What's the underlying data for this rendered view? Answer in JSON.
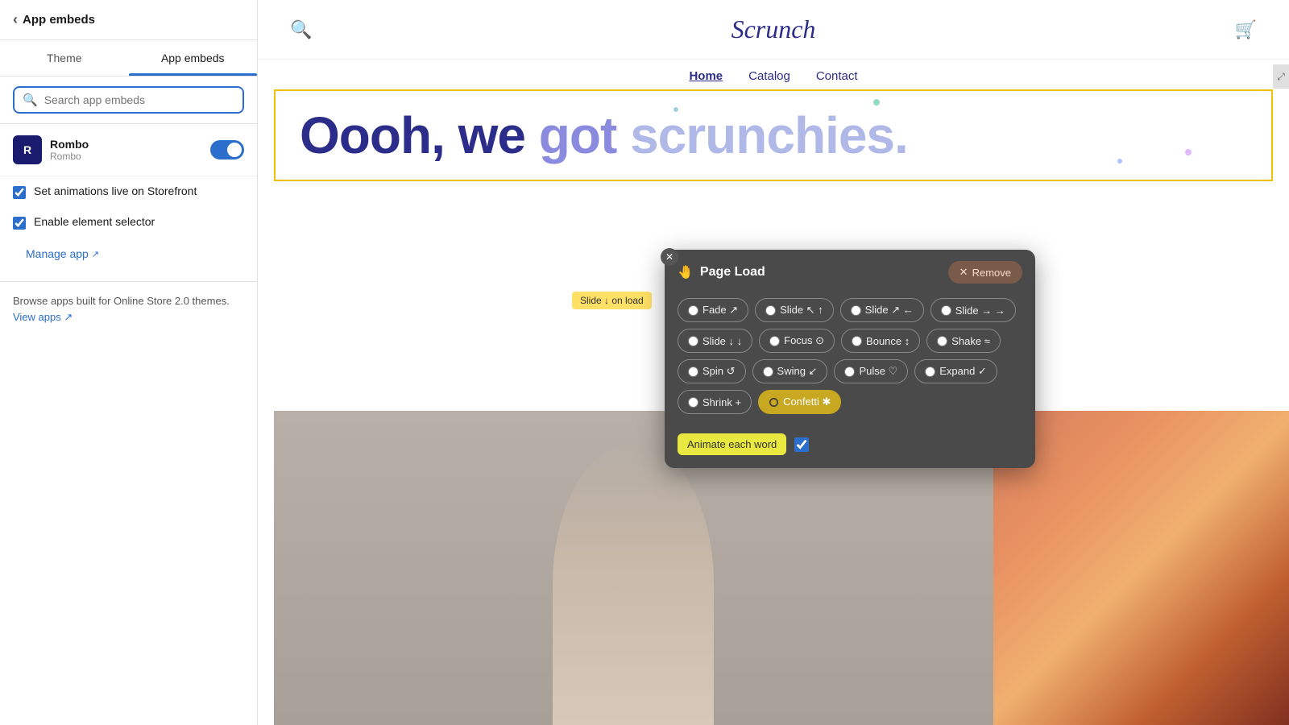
{
  "sidebar": {
    "back_label": "App embeds",
    "tabs": [
      {
        "label": "Theme",
        "active": false
      },
      {
        "label": "App embeds",
        "active": true
      }
    ],
    "search_placeholder": "Search app embeds",
    "app": {
      "name": "Rombo",
      "sub": "Rombo",
      "icon_letter": "R",
      "toggle_on": true
    },
    "checkboxes": [
      {
        "label": "Set animations live on Storefront",
        "checked": true
      },
      {
        "label": "Enable element selector",
        "checked": true
      }
    ],
    "manage_link": "Manage app",
    "footer_text": "Browse apps built for Online Store 2.0 themes.",
    "view_apps": "View apps"
  },
  "storefront": {
    "logo": "Scrunch",
    "nav": [
      "Home",
      "Catalog",
      "Contact"
    ],
    "active_nav": "Home",
    "hero_text": "Oooh, we got scrunchies.",
    "hero_words": [
      "Oooh,",
      "we",
      "got",
      "scrunchies."
    ]
  },
  "animation_panel": {
    "title": "Page Load",
    "title_icon": "🤚",
    "remove_label": "Remove",
    "options": [
      {
        "label": "Fade ↗ ↙",
        "selected": false
      },
      {
        "label": "Slide ↖ ↑",
        "selected": false
      },
      {
        "label": "Slide ↗ ↙",
        "selected": false
      },
      {
        "label": "Slide → →",
        "selected": false
      },
      {
        "label": "Slide ↓ ↓",
        "selected": false
      },
      {
        "label": "Focus ⊙",
        "selected": false
      },
      {
        "label": "Bounce ↕",
        "selected": false
      },
      {
        "label": "Shake ≈",
        "selected": false
      },
      {
        "label": "Spin ↺",
        "selected": false
      },
      {
        "label": "Swing ↙",
        "selected": false
      },
      {
        "label": "Pulse ♡",
        "selected": false
      },
      {
        "label": "Expand ✓",
        "selected": false
      },
      {
        "label": "Shrink +",
        "selected": false
      },
      {
        "label": "Confetti ✱",
        "selected": true
      }
    ],
    "animate_each_word": "Animate each word",
    "animate_each_word_checked": true
  },
  "slide_badge": "Slide ↓ on load",
  "colors": {
    "accent": "#2c6ecb",
    "panel_bg": "#4a4a4a",
    "selected_option": "#c8a820",
    "hero_blue": "#2c2c8a"
  }
}
